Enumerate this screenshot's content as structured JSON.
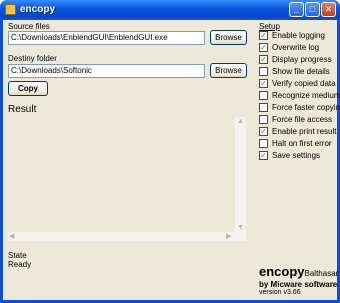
{
  "window": {
    "title": "encopy"
  },
  "titlebar_buttons": {
    "minimize": "_",
    "maximize": "□",
    "close": "✕"
  },
  "source": {
    "label": "Source files",
    "value": "C:\\Downloads\\EnblendGUI\\EnblendGUI.exe",
    "browse_label": "Browse"
  },
  "destiny": {
    "label": "Destiny folder",
    "value": "C:\\Downloads\\Softonic",
    "browse_label": "Browse"
  },
  "copy_button": "Copy",
  "result": {
    "label": "Result"
  },
  "state": {
    "label": "State",
    "value": "Ready"
  },
  "setup": {
    "title": "Setup",
    "options": [
      {
        "label": "Enable logging",
        "checked": true
      },
      {
        "label": "Overwrite log",
        "checked": true
      },
      {
        "label": "Display progress",
        "checked": true
      },
      {
        "label": "Show file details",
        "checked": false
      },
      {
        "label": "Verify copied data",
        "checked": true
      },
      {
        "label": "Recognize medium",
        "checked": false
      },
      {
        "label": "Force faster copying",
        "checked": false
      },
      {
        "label": "Force file access",
        "checked": false
      },
      {
        "label": "Enable print result",
        "checked": true
      },
      {
        "label": "Halt on first error",
        "checked": false
      },
      {
        "label": "Save settings",
        "checked": true
      }
    ]
  },
  "branding": {
    "name": "encopy",
    "author": "Balthasar",
    "by": "by Micware software",
    "version": "version v3.66"
  },
  "colors": {
    "titlebar": "#0a58e0",
    "window_bg": "#ece9d8",
    "checkmark": "#21a121"
  }
}
